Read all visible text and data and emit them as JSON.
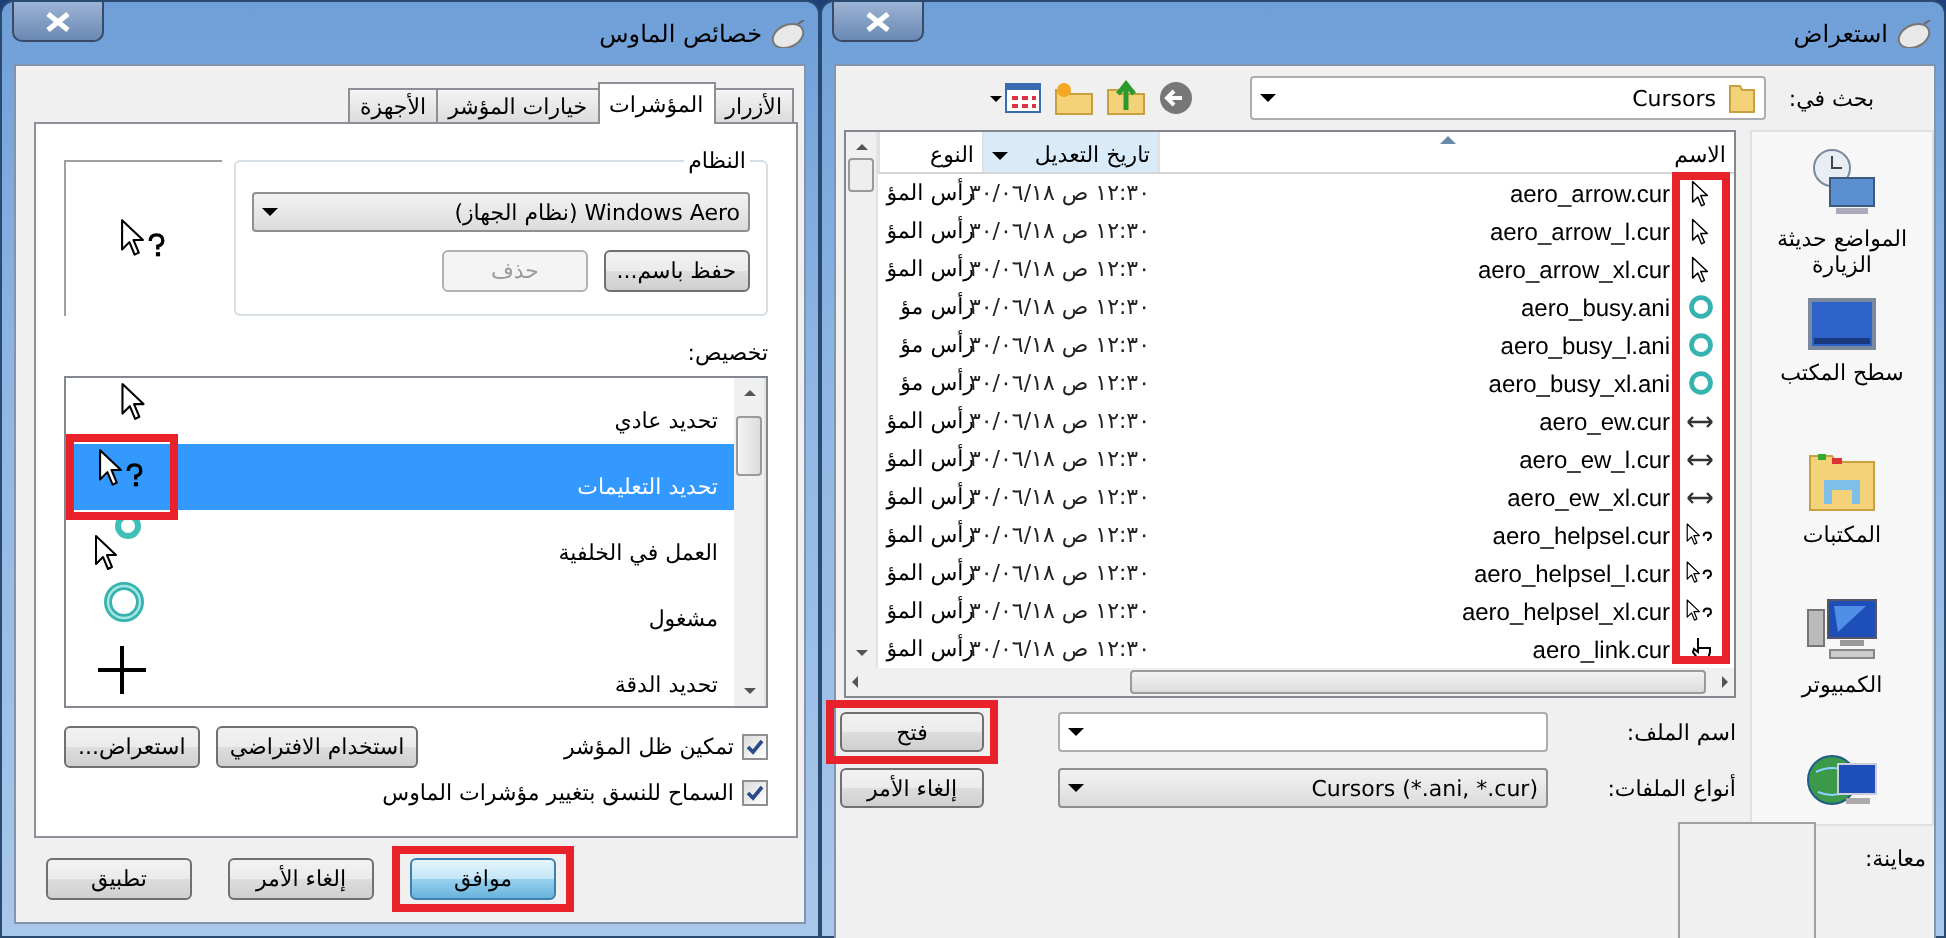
{
  "mouse_window": {
    "title": "خصائص الماوس",
    "tabs": [
      {
        "label": "الأزرار",
        "selected": false
      },
      {
        "label": "المؤشرات",
        "selected": true
      },
      {
        "label": "خيارات المؤشر",
        "selected": false
      },
      {
        "label": "الأجهزة",
        "selected": false
      }
    ],
    "scheme": {
      "legend": "النظام",
      "value": "Windows Aero (نظام الجهاز)",
      "buttons": [
        {
          "label": "حفظ باسم...",
          "disabled": false
        },
        {
          "label": "حذف",
          "disabled": true
        }
      ]
    },
    "customize_label": "تخصيص:",
    "cursor_rows": [
      {
        "label": "تحديد عادي",
        "kind": "arrow",
        "selected": false,
        "highlighted": false
      },
      {
        "label": "تحديد التعليمات",
        "kind": "help",
        "selected": true,
        "highlighted": true
      },
      {
        "label": "العمل في الخلفية",
        "kind": "working",
        "selected": false,
        "highlighted": false
      },
      {
        "label": "مشغول",
        "kind": "busy",
        "selected": false,
        "highlighted": false
      },
      {
        "label": "تحديد الدقة",
        "kind": "precision",
        "selected": false,
        "highlighted": false
      }
    ],
    "shadow": {
      "label": "تمكين ظل المؤشر",
      "checked": true
    },
    "side_buttons": [
      "استخدام الافتراضي",
      "استعراض..."
    ],
    "allow_themes": {
      "label": "السماح للنسق بتغيير مؤشرات الماوس",
      "checked": true
    },
    "footer_buttons": [
      {
        "label": "موافق",
        "default": true,
        "highlighted": true
      },
      {
        "label": "إلغاء الأمر",
        "default": false,
        "highlighted": false
      },
      {
        "label": "تطبيق",
        "default": false,
        "highlighted": false
      }
    ]
  },
  "browse_window": {
    "title": "استعراض",
    "look_in_label": "بحث في:",
    "look_in": "Cursors",
    "places": [
      {
        "kind": "recent",
        "label": "المواضع حديثة الزيارة"
      },
      {
        "kind": "desktop",
        "label": "سطح المكتب"
      },
      {
        "kind": "libraries",
        "label": "المكتبات"
      },
      {
        "kind": "computer",
        "label": "الكمبيوتر"
      },
      {
        "kind": "network"
      }
    ],
    "columns": [
      "الاسم",
      "تاريخ التعديل",
      "النوع"
    ],
    "icon_column_highlighted": true,
    "files": [
      {
        "name": "aero_arrow.cur",
        "kind": "arrow",
        "date": "١٢:٣٠ ص ٣٠/٠٦/١٨",
        "type": "رأس المؤ"
      },
      {
        "name": "aero_arrow_l.cur",
        "kind": "arrow",
        "date": "١٢:٣٠ ص ٣٠/٠٦/١٨",
        "type": "رأس المؤ"
      },
      {
        "name": "aero_arrow_xl.cur",
        "kind": "arrow",
        "date": "١٢:٣٠ ص ٣٠/٠٦/١٨",
        "type": "رأس المؤ"
      },
      {
        "name": "aero_busy.ani",
        "kind": "busy",
        "date": "١٢:٣٠ ص ٣٠/٠٦/١٨",
        "type": "رأس مؤ"
      },
      {
        "name": "aero_busy_l.ani",
        "kind": "busy",
        "date": "١٢:٣٠ ص ٣٠/٠٦/١٨",
        "type": "رأس مؤ"
      },
      {
        "name": "aero_busy_xl.ani",
        "kind": "busy",
        "date": "١٢:٣٠ ص ٣٠/٠٦/١٨",
        "type": "رأس مؤ"
      },
      {
        "name": "aero_ew.cur",
        "kind": "resize",
        "date": "١٢:٣٠ ص ٣٠/٠٦/١٨",
        "type": "رأس المؤ"
      },
      {
        "name": "aero_ew_l.cur",
        "kind": "resize",
        "date": "١٢:٣٠ ص ٣٠/٠٦/١٨",
        "type": "رأس المؤ"
      },
      {
        "name": "aero_ew_xl.cur",
        "kind": "resize",
        "date": "١٢:٣٠ ص ٣٠/٠٦/١٨",
        "type": "رأس المؤ"
      },
      {
        "name": "aero_helpsel.cur",
        "kind": "help",
        "date": "١٢:٣٠ ص ٣٠/٠٦/١٨",
        "type": "رأس المؤ"
      },
      {
        "name": "aero_helpsel_l.cur",
        "kind": "help",
        "date": "١٢:٣٠ ص ٣٠/٠٦/١٨",
        "type": "رأس المؤ"
      },
      {
        "name": "aero_helpsel_xl.cur",
        "kind": "help",
        "date": "١٢:٣٠ ص ٣٠/٠٦/١٨",
        "type": "رأس المؤ"
      },
      {
        "name": "aero_link.cur",
        "kind": "link",
        "date": "١٢:٣٠ ص ٣٠/٠٦/١٨",
        "type": "رأس المؤ"
      }
    ],
    "file_name_label": "اسم الملف:",
    "file_types_label": "أنواع الملفات:",
    "file_type": "Cursors (*.ani, *.cur)",
    "buttons": [
      {
        "label": "فتح",
        "highlighted": true
      },
      {
        "label": "إلغاء الأمر",
        "highlighted": false
      }
    ],
    "preview_label": "معاينة:"
  }
}
